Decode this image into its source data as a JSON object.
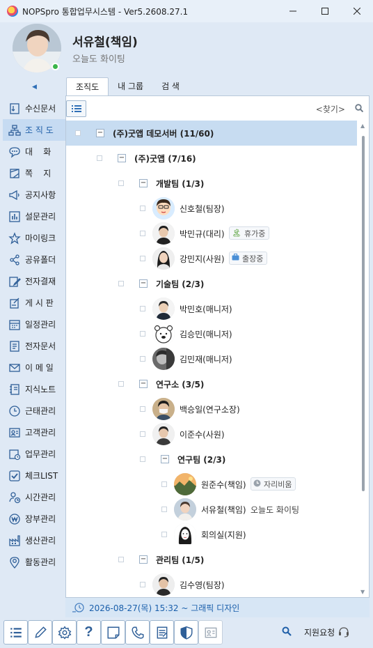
{
  "window": {
    "title": "NOPSpro 통합업무시스템 - Ver5.2608.27.1"
  },
  "profile": {
    "name": "서유철(책임)",
    "status_message": "오늘도  화이팅"
  },
  "tabs": [
    {
      "label": "조직도",
      "active": true
    },
    {
      "label": "내 그룹",
      "active": false
    },
    {
      "label": "검 색",
      "active": false
    }
  ],
  "toolbar": {
    "find_label": "<찾기>"
  },
  "nav": [
    {
      "label": "수신문서",
      "icon": "inbox-doc-icon"
    },
    {
      "label": "조 직 도",
      "icon": "org-chart-icon",
      "active": true
    },
    {
      "label": "대    화",
      "icon": "chat-bubble-icon"
    },
    {
      "label": "쪽    지",
      "icon": "note-icon"
    },
    {
      "label": "공지사항",
      "icon": "megaphone-icon"
    },
    {
      "label": "설문관리",
      "icon": "survey-chart-icon"
    },
    {
      "label": "마이링크",
      "icon": "star-icon"
    },
    {
      "label": "공유폴더",
      "icon": "share-icon"
    },
    {
      "label": "전자결재",
      "icon": "approval-pen-icon"
    },
    {
      "label": "게 시 판",
      "icon": "board-icon"
    },
    {
      "label": "일정관리",
      "icon": "calendar-icon"
    },
    {
      "label": "전자문서",
      "icon": "document-icon"
    },
    {
      "label": "이 메 일",
      "icon": "mail-icon"
    },
    {
      "label": "지식노트",
      "icon": "notebook-icon"
    },
    {
      "label": "근태관리",
      "icon": "clock-icon"
    },
    {
      "label": "고객관리",
      "icon": "contact-card-icon"
    },
    {
      "label": "업무관리",
      "icon": "task-calendar-icon"
    },
    {
      "label": "체크LIST",
      "icon": "checklist-icon"
    },
    {
      "label": "시간관리",
      "icon": "person-time-icon"
    },
    {
      "label": "장부관리",
      "icon": "won-coin-icon"
    },
    {
      "label": "생산관리",
      "icon": "factory-icon"
    },
    {
      "label": "활동관리",
      "icon": "location-pin-icon"
    }
  ],
  "tree": [
    {
      "type": "org",
      "level": 0,
      "label": "(주)굿앱 데모서버 (11/60)",
      "selected": true
    },
    {
      "type": "org",
      "level": 1,
      "label": "(주)굿앱 (7/16)"
    },
    {
      "type": "org",
      "level": 2,
      "label": "개발팀 (1/3)"
    },
    {
      "type": "member",
      "level": 3,
      "label": "신호철(팀장)",
      "avatar": "cartoon"
    },
    {
      "type": "member",
      "level": 3,
      "label": "박민규(대리)",
      "avatar": "man",
      "badge": {
        "icon": "palm-tree-icon",
        "text": "휴가중"
      }
    },
    {
      "type": "member",
      "level": 3,
      "label": "강민지(사원)",
      "avatar": "woman",
      "badge": {
        "icon": "briefcase-icon",
        "text": "출장중"
      }
    },
    {
      "type": "org",
      "level": 2,
      "label": "기술팀 (2/3)"
    },
    {
      "type": "member",
      "level": 3,
      "label": "박민호(매니저)",
      "avatar": "man2"
    },
    {
      "type": "member",
      "level": 3,
      "label": "김승민(매니저)",
      "avatar": "bear"
    },
    {
      "type": "member",
      "level": 3,
      "label": "김민재(매니저)",
      "avatar": "bw"
    },
    {
      "type": "org",
      "level": 2,
      "label": "연구소 (3/5)"
    },
    {
      "type": "member",
      "level": 3,
      "label": "백승일(연구소장)",
      "avatar": "mask"
    },
    {
      "type": "member",
      "level": 3,
      "label": "이준수(사원)",
      "avatar": "man3"
    },
    {
      "type": "org",
      "level": 3,
      "label": "연구팀 (2/3)"
    },
    {
      "type": "member",
      "level": 4,
      "label": "원준수(책임)",
      "avatar": "landscape",
      "badge": {
        "icon": "clock-badge-icon",
        "text": "자리비움"
      }
    },
    {
      "type": "member",
      "level": 4,
      "label": "서유철(책임)",
      "avatar": "young",
      "status": "오늘도  화이팅"
    },
    {
      "type": "member",
      "level": 4,
      "label": "회의실(지원)",
      "avatar": "drawing"
    },
    {
      "type": "org",
      "level": 2,
      "label": "관리팀 (1/5)"
    },
    {
      "type": "member",
      "level": 3,
      "label": "김수영(팀장)",
      "avatar": "man4"
    }
  ],
  "event": {
    "text": "2026-08-27(목)  15:32 ~  그래픽 디자인"
  },
  "bottom": {
    "buttons": [
      "list-icon",
      "pencil-icon",
      "settings-gear-icon",
      "help-question-icon",
      "memo-icon",
      "phone-icon",
      "report-icon",
      "security-shield-icon",
      "id-card-icon"
    ],
    "support_label": "지원요청"
  },
  "colors": {
    "accent": "#1f5fa8",
    "selection": "#c7dcf1",
    "background": "#dfe9f5",
    "online": "#3ab54a"
  }
}
